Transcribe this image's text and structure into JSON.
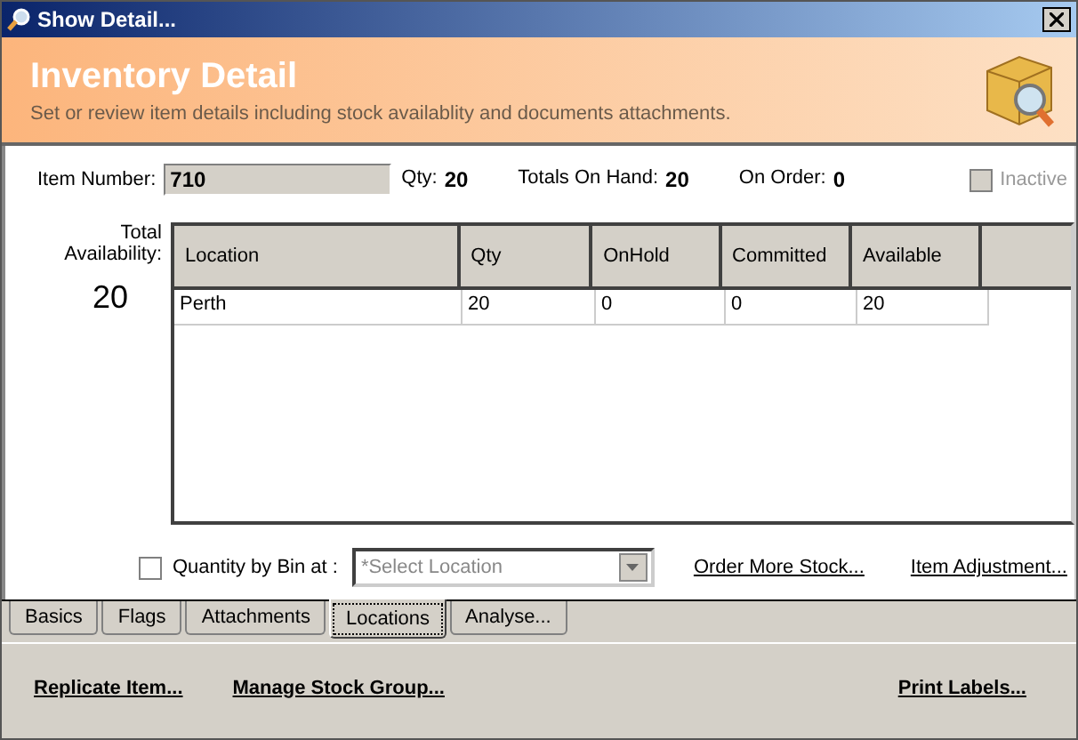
{
  "window": {
    "title": "Show Detail..."
  },
  "header": {
    "title": "Inventory Detail",
    "subtitle": "Set or review item details including stock availablity and documents attachments."
  },
  "item_number": {
    "label": "Item Number:",
    "value": "710"
  },
  "summary": [
    {
      "label": "Qty:",
      "value": "20"
    },
    {
      "label": "Totals On Hand:",
      "value": "20"
    },
    {
      "label": "On Order:",
      "value": "0"
    }
  ],
  "inactive": {
    "label": "Inactive",
    "checked": false,
    "disabled": true
  },
  "total_availability": {
    "label": "Total Availability:",
    "value": "20"
  },
  "table": {
    "columns": [
      "Location",
      "Qty",
      "OnHold",
      "Committed",
      "Available"
    ],
    "rows": [
      [
        "Perth",
        "20",
        "0",
        "0",
        "20"
      ]
    ]
  },
  "quantity_by_bin": {
    "label": "Quantity by Bin at :",
    "checked": false
  },
  "location_select": {
    "placeholder": "*Select Location"
  },
  "links": [
    "Order More Stock...",
    "Item Adjustment..."
  ],
  "tabs": [
    {
      "label": "Basics",
      "selected": false
    },
    {
      "label": "Flags",
      "selected": false
    },
    {
      "label": "Attachments",
      "selected": false
    },
    {
      "label": "Locations",
      "selected": true
    },
    {
      "label": "Analyse...",
      "selected": false
    }
  ],
  "footer_links": [
    "Replicate Item...",
    "Manage Stock Group...",
    "Print Labels..."
  ]
}
